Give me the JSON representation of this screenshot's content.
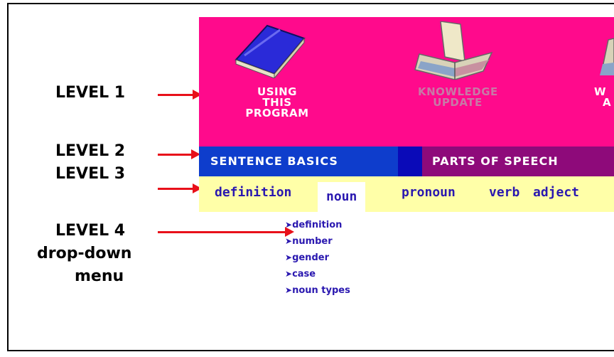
{
  "labels": {
    "level1": "LEVEL 1",
    "level2": "LEVEL 2",
    "level3": "LEVEL 3",
    "level4": "LEVEL 4",
    "level4_line2": "drop-down",
    "level4_line3": "menu"
  },
  "level1_nav": [
    {
      "line1": "USING THIS",
      "line2": "PROGRAM",
      "icon": "closed-book-icon"
    },
    {
      "line1": "KNOWLEDGE",
      "line2": "UPDATE",
      "icon": "open-book-icon"
    },
    {
      "line1": "W",
      "line2": "A",
      "icon": "open-book-icon"
    }
  ],
  "level2_tabs": [
    "SENTENCE BASICS",
    "PARTS OF SPEECH"
  ],
  "level3_items": [
    "definition",
    "noun",
    "pronoun",
    "verb",
    "adject"
  ],
  "level4_menu": [
    "definition",
    "number",
    "gender",
    "case",
    "noun types"
  ],
  "colors": {
    "pink": "#ff0a8c",
    "blue": "#0a0ab8",
    "yellow": "#ffffa8",
    "arrow": "#e8101a"
  }
}
